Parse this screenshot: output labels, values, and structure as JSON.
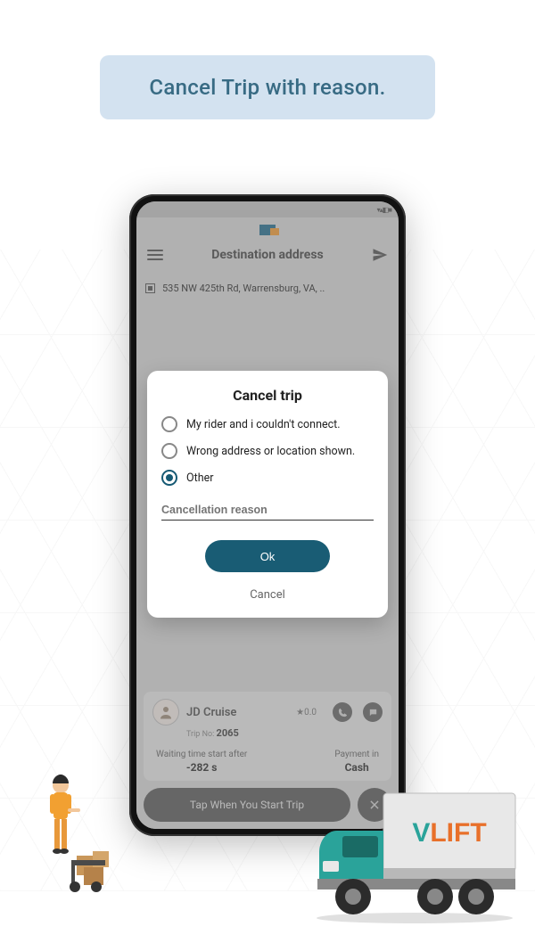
{
  "banner": {
    "title": "Cancel Trip with reason."
  },
  "appbar": {
    "title": "Destination address",
    "address": "535 NW 425th Rd, Warrensburg, VA, .."
  },
  "rider": {
    "name": "JD Cruise",
    "rating": "★0.0",
    "trip_no_label": "Trip No:",
    "trip_no": "2065",
    "waiting_label": "Waiting time start after",
    "waiting_value": "-282 s",
    "payment_label": "Payment in",
    "payment_value": "Cash"
  },
  "start_button": "Tap When You Start Trip",
  "modal": {
    "title": "Cancel trip",
    "options": [
      "My rider and i couldn't connect.",
      "Wrong address or location shown.",
      "Other"
    ],
    "selected_index": 2,
    "reason_placeholder": "Cancellation reason",
    "ok": "Ok",
    "cancel": "Cancel"
  },
  "brand": {
    "vlift_v": "V",
    "vlift_rest": "LIFT"
  }
}
